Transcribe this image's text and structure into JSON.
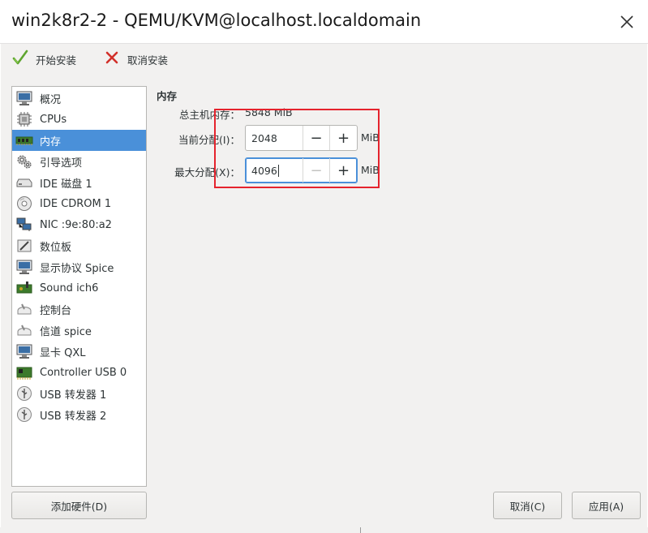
{
  "window": {
    "title": "win2k8r2-2 - QEMU/KVM@localhost.localdomain",
    "close_icon": "close-icon"
  },
  "toolbar": {
    "begin_install_label": "开始安装",
    "begin_install_icon": "checkmark-icon",
    "cancel_install_label": "取消安装",
    "cancel_install_icon": "cross-icon"
  },
  "sidebar": {
    "items": [
      {
        "label": "概况",
        "icon": "monitor-icon"
      },
      {
        "label": "CPUs",
        "icon": "cpu-icon"
      },
      {
        "label": "内存",
        "icon": "memory-icon"
      },
      {
        "label": "引导选项",
        "icon": "gears-icon"
      },
      {
        "label": "IDE 磁盘 1",
        "icon": "disk-icon"
      },
      {
        "label": "IDE CDROM 1",
        "icon": "cdrom-icon"
      },
      {
        "label": "NIC :9e:80:a2",
        "icon": "network-icon"
      },
      {
        "label": "数位板",
        "icon": "tablet-icon"
      },
      {
        "label": "显示协议 Spice",
        "icon": "display-icon"
      },
      {
        "label": "Sound ich6",
        "icon": "sound-card-icon"
      },
      {
        "label": "控制台",
        "icon": "serial-icon"
      },
      {
        "label": "信道 spice",
        "icon": "channel-icon"
      },
      {
        "label": "显卡 QXL",
        "icon": "video-card-icon"
      },
      {
        "label": "Controller USB 0",
        "icon": "controller-icon"
      },
      {
        "label": "USB 转发器 1",
        "icon": "usb-icon"
      },
      {
        "label": "USB 转发器 2",
        "icon": "usb-icon"
      }
    ],
    "selected_index": 2
  },
  "memory": {
    "section_title": "内存",
    "total_label": "总主机内存：",
    "total_value": "5848 MiB",
    "current_label": "当前分配(I)：",
    "current_value": "2048",
    "current_unit": "MiB",
    "max_label": "最大分配(X)：",
    "max_value": "4096",
    "max_unit": "MiB"
  },
  "buttons": {
    "add_hardware": "添加硬件(D)",
    "cancel": "取消(C)",
    "apply": "应用(A)"
  },
  "colors": {
    "selection": "#4a90d9",
    "highlight_box": "#e5232d"
  }
}
